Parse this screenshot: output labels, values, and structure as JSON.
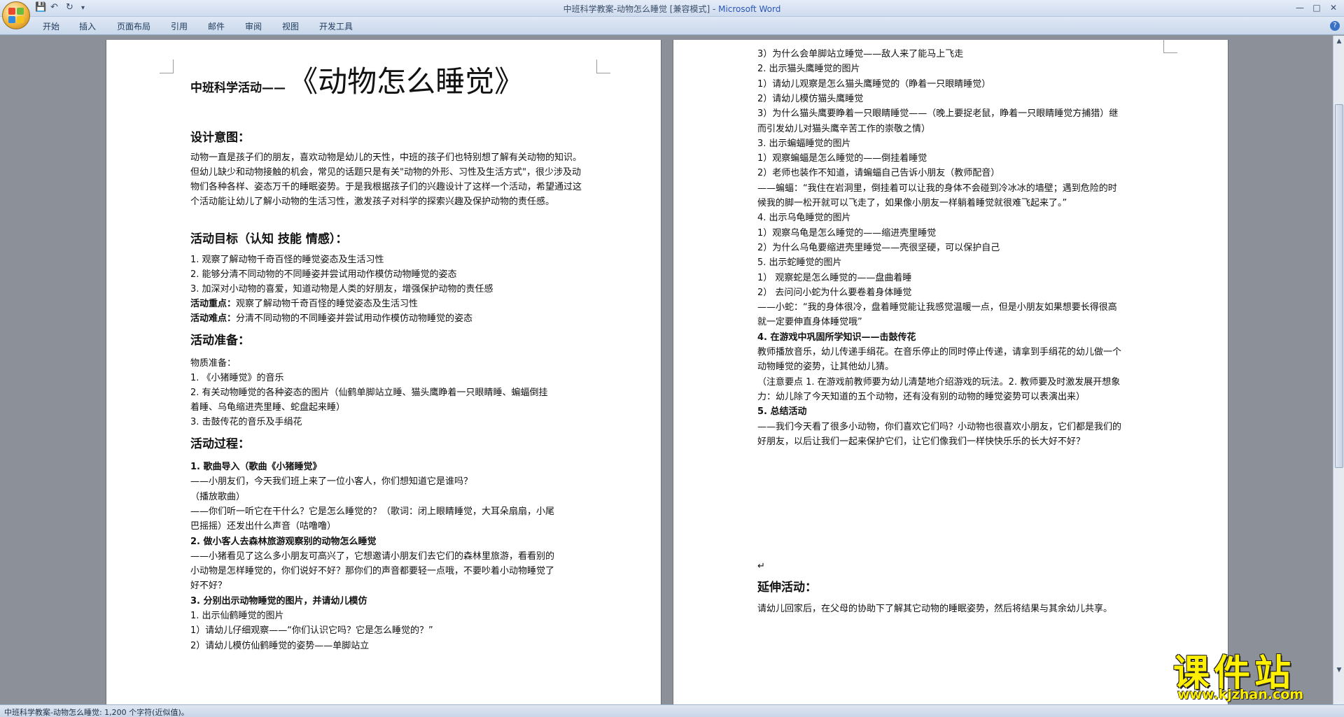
{
  "window": {
    "title_doc": "中班科学教案-动物怎么睡觉 [兼容模式] - ",
    "title_app": "Microsoft Word",
    "minimize": "—",
    "maximize": "□",
    "close": "✕"
  },
  "qat": {
    "save": "💾",
    "undo": "↶",
    "redo": "↻",
    "more": "▾"
  },
  "ribbon": {
    "tabs": [
      "开始",
      "插入",
      "页面布局",
      "引用",
      "邮件",
      "审阅",
      "视图",
      "开发工具"
    ],
    "help": "?"
  },
  "left_page": {
    "title_prefix": "中班科学活动——",
    "title_main": "《动物怎么睡觉》",
    "design_heading": "设计意图：",
    "design_body": "动物一直是孩子们的朋友，喜欢动物是幼儿的天性，中班的孩子们也特别想了解有关动物的知识。但幼儿缺少和动物接触的机会，常见的话题只是有关\"动物的外形、习性及生活方式\"，很少涉及动物们各种各样、姿态万千的睡眠姿势。于是我根据孩子们的兴趣设计了这样一个活动，希望通过这个活动能让幼儿了解小动物的生活习性，激发孩子对科学的探索兴趣及保护动物的责任感。",
    "goals_heading": "活动目标（认知  技能  情感）：",
    "goals": [
      "1.   观察了解动物千奇百怪的睡觉姿态及生活习性",
      "2.   能够分清不同动物的不同睡姿并尝试用动作模仿动物睡觉的姿态",
      "3.   加深对小动物的喜爱，知道动物是人类的好朋友，增强保护动物的责任感"
    ],
    "key_label": "活动重点：",
    "key_text": "观察了解动物千奇百怪的睡觉姿态及生活习性",
    "diff_label": "活动难点：",
    "diff_text": "分清不同动物的不同睡姿并尝试用动作模仿动物睡觉的姿态",
    "prep_heading": "活动准备：",
    "prep_intro": "物质准备：",
    "prep_items": [
      "1.   《小猪睡觉》的音乐",
      "2.   有关动物睡觉的各种姿态的图片（仙鹤单脚站立睡、猫头鹰睁着一只眼睛睡、蝙蝠倒挂",
      "      着睡、乌龟缩进壳里睡、蛇盘起来睡）",
      "3.   击鼓传花的音乐及手绢花"
    ],
    "process_heading": "活动过程：",
    "process": [
      {
        "text": "1.   歌曲导入（歌曲《小猪睡觉》",
        "bold": true
      },
      {
        "text": "——小朋友们，今天我们班上来了一位小客人，你们想知道它是谁吗？",
        "bold": false
      },
      {
        "text": "（播放歌曲）",
        "bold": false
      },
      {
        "text": "——你们听一听它在干什么？它是怎么睡觉的？（歌词：闭上眼睛睡觉，大耳朵扇扇，小尾",
        "bold": false
      },
      {
        "text": "巴摇摇）还发出什么声音（咕噜噜）",
        "bold": false
      },
      {
        "text": "2.   做小客人去森林旅游观察别的动物怎么睡觉",
        "bold": true
      },
      {
        "text": "——小猪看见了这么多小朋友可高兴了，它想邀请小朋友们去它们的森林里旅游，看看别的",
        "bold": false
      },
      {
        "text": "小动物是怎样睡觉的，你们说好不好？那你们的声音都要轻一点哦，不要吵着小动物睡觉了",
        "bold": false
      },
      {
        "text": "好不好？",
        "bold": false
      },
      {
        "text": "3.   分别出示动物睡觉的图片，并请幼儿模仿",
        "bold": true
      },
      {
        "text": "1. 出示仙鹤睡觉的图片",
        "bold": false
      },
      {
        "text": "1）请幼儿仔细观察——“你们认识它吗？它是怎么睡觉的？”",
        "bold": false
      },
      {
        "text": "2）请幼儿模仿仙鹤睡觉的姿势——单脚站立",
        "bold": false
      }
    ]
  },
  "right_page": {
    "lines": [
      {
        "text": "3）为什么会单脚站立睡觉——敌人来了能马上飞走",
        "bold": false
      },
      {
        "text": "2. 出示猫头鹰睡觉的图片",
        "bold": false
      },
      {
        "text": "1）请幼儿观察是怎么猫头鹰睡觉的（睁着一只眼睛睡觉）",
        "bold": false
      },
      {
        "text": "2）请幼儿模仿猫头鹰睡觉",
        "bold": false
      },
      {
        "text": "3）为什么猫头鹰要睁着一只眼睛睡觉——（晚上要捉老鼠，睁着一只眼睛睡觉方捕猎）继",
        "bold": false
      },
      {
        "text": "而引发幼儿对猫头鹰辛苦工作的崇敬之情）",
        "bold": false
      },
      {
        "text": "3. 出示蝙蝠睡觉的图片",
        "bold": false
      },
      {
        "text": "1）观察蝙蝠是怎么睡觉的——倒挂着睡觉",
        "bold": false
      },
      {
        "text": "2）老师也装作不知道，请蝙蝠自己告诉小朋友（教师配音）",
        "bold": false
      },
      {
        "text": "——蝙蝠：“我住在岩洞里，倒挂着可以让我的身体不会碰到冷冰冰的墙壁；遇到危险的时",
        "bold": false
      },
      {
        "text": "    候我的脚一松开就可以飞走了，如果像小朋友一样躺着睡觉就很难飞起来了。”",
        "bold": false
      },
      {
        "text": "4.   出示乌龟睡觉的图片",
        "bold": false
      },
      {
        "text": "1）观察乌龟是怎么睡觉的——缩进壳里睡觉",
        "bold": false
      },
      {
        "text": "2）为什么乌龟要缩进壳里睡觉——壳很坚硬，可以保护自己",
        "bold": false
      },
      {
        "text": "5.   出示蛇睡觉的图片",
        "bold": false
      },
      {
        "text": "1）  观察蛇是怎么睡觉的——盘曲着睡",
        "bold": false
      },
      {
        "text": "2）  去问问小蛇为什么要卷着身体睡觉",
        "bold": false
      },
      {
        "text": "——小蛇：“我的身体很冷，盘着睡觉能让我感觉温暖一点，但是小朋友如果想要长得很高",
        "bold": false
      },
      {
        "text": "    就一定要伸直身体睡觉哦”",
        "bold": false
      },
      {
        "text": "4.   在游戏中巩固所学知识——击鼓传花",
        "bold": true
      },
      {
        "text": "教师播放音乐，幼儿传递手绢花。在音乐停止的同时停止传递，请拿到手绢花的幼儿做一个",
        "bold": false
      },
      {
        "text": "动物睡觉的姿势，让其他幼儿猜。",
        "bold": false
      },
      {
        "text": "（注意要点 1. 在游戏前教师要为幼儿清楚地介绍游戏的玩法。2. 教师要及时激发展开想象",
        "bold": false
      },
      {
        "text": "力：幼儿除了今天知道的五个动物，还有没有别的动物的睡觉姿势可以表演出来）",
        "bold": false
      },
      {
        "text": "5.   总结活动",
        "bold": true
      },
      {
        "text": "——我们今天看了很多小动物，你们喜欢它们吗？小动物也很喜欢小朋友，它们都是我们的",
        "bold": false
      },
      {
        "text": "好朋友，以后让我们一起来保护它们，让它们像我们一样快快乐乐的长大好不好？",
        "bold": false
      }
    ],
    "extend_heading": "延伸活动：",
    "extend_body": "请幼儿回家后，在父母的协助下了解其它动物的睡眠姿势，然后将结果与其余幼儿共享。"
  },
  "status_bar": {
    "text": "中班科学教案-动物怎么睡觉: 1,200 个字符(近似值)。"
  },
  "watermark": {
    "main": "课件站",
    "url": "www.kjzhan.com"
  },
  "marks": {
    "para": "↵"
  },
  "colors": {
    "accent": "#2a56b8",
    "watermark": "#ffef00",
    "workspace": "#8c9199"
  }
}
